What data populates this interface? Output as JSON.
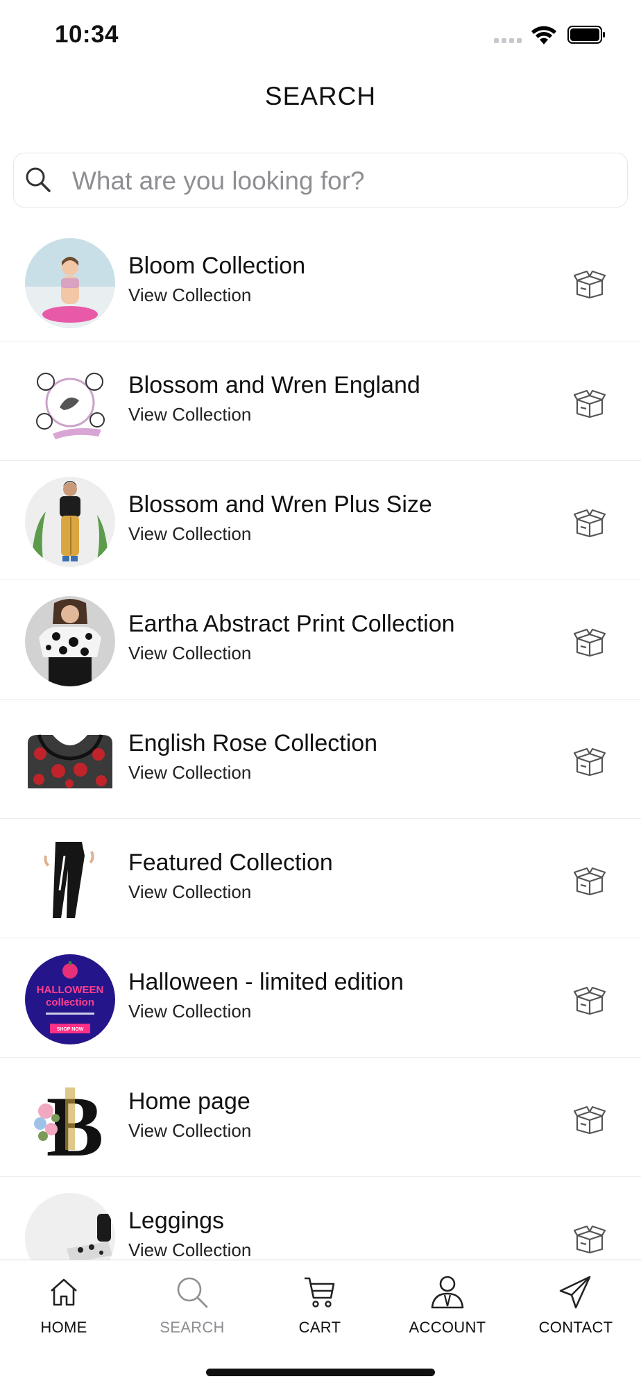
{
  "status": {
    "time": "10:34"
  },
  "header": {
    "title": "SEARCH"
  },
  "search": {
    "placeholder": "What are you looking for?",
    "value": ""
  },
  "collections": [
    {
      "title": "Bloom Collection",
      "subtitle": "View Collection"
    },
    {
      "title": "Blossom and Wren England",
      "subtitle": "View Collection"
    },
    {
      "title": "Blossom and Wren Plus Size",
      "subtitle": "View Collection"
    },
    {
      "title": "Eartha Abstract Print Collection",
      "subtitle": "View Collection"
    },
    {
      "title": "English Rose Collection",
      "subtitle": "View Collection"
    },
    {
      "title": "Featured Collection",
      "subtitle": "View Collection"
    },
    {
      "title": "Halloween - limited edition",
      "subtitle": "View Collection"
    },
    {
      "title": "Home page",
      "subtitle": "View Collection"
    },
    {
      "title": "Leggings",
      "subtitle": "View Collection"
    }
  ],
  "thumb_text": {
    "halloween": {
      "line1": "HALLOWEEN",
      "line2": "collection",
      "cta": "SHOP NOW"
    },
    "home": {
      "letter": "B"
    }
  },
  "tabs": [
    {
      "label": "HOME",
      "icon": "home-icon"
    },
    {
      "label": "SEARCH",
      "icon": "search-icon"
    },
    {
      "label": "CART",
      "icon": "cart-icon"
    },
    {
      "label": "ACCOUNT",
      "icon": "account-icon"
    },
    {
      "label": "CONTACT",
      "icon": "paper-plane-icon"
    }
  ],
  "colors": {
    "active_tab": "#8e8e93",
    "text": "#111111",
    "divider": "#ececec"
  }
}
